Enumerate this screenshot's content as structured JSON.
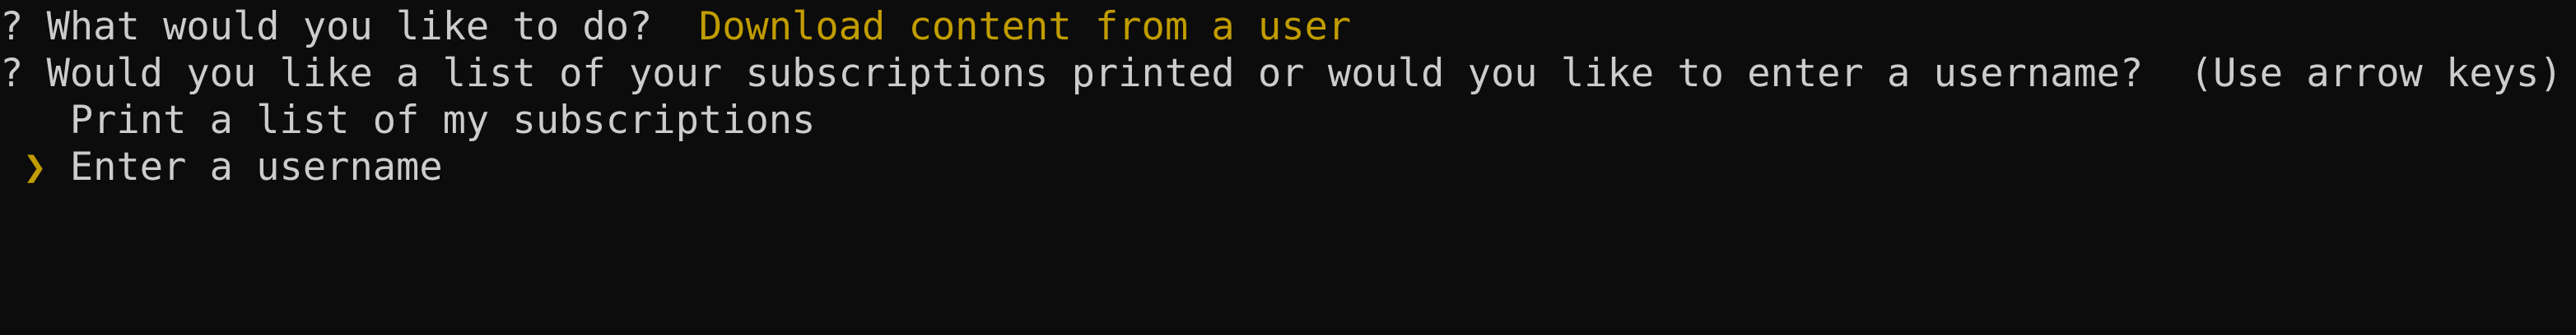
{
  "terminal": {
    "q1": {
      "marker": "?",
      "question": "What would you like to do?",
      "answer": "Download content from a user"
    },
    "q2": {
      "marker": "?",
      "question": "Would you like a list of your subscriptions printed or would you like to enter a username?",
      "hint": "(Use arrow keys)"
    },
    "choices": [
      {
        "label": "Print a list of my subscriptions",
        "pointer": ""
      },
      {
        "label": "Enter a username",
        "pointer": "❯"
      }
    ],
    "colors": {
      "background": "#0c0c0c",
      "text": "#cccccc",
      "accent": "#c19c00"
    }
  }
}
